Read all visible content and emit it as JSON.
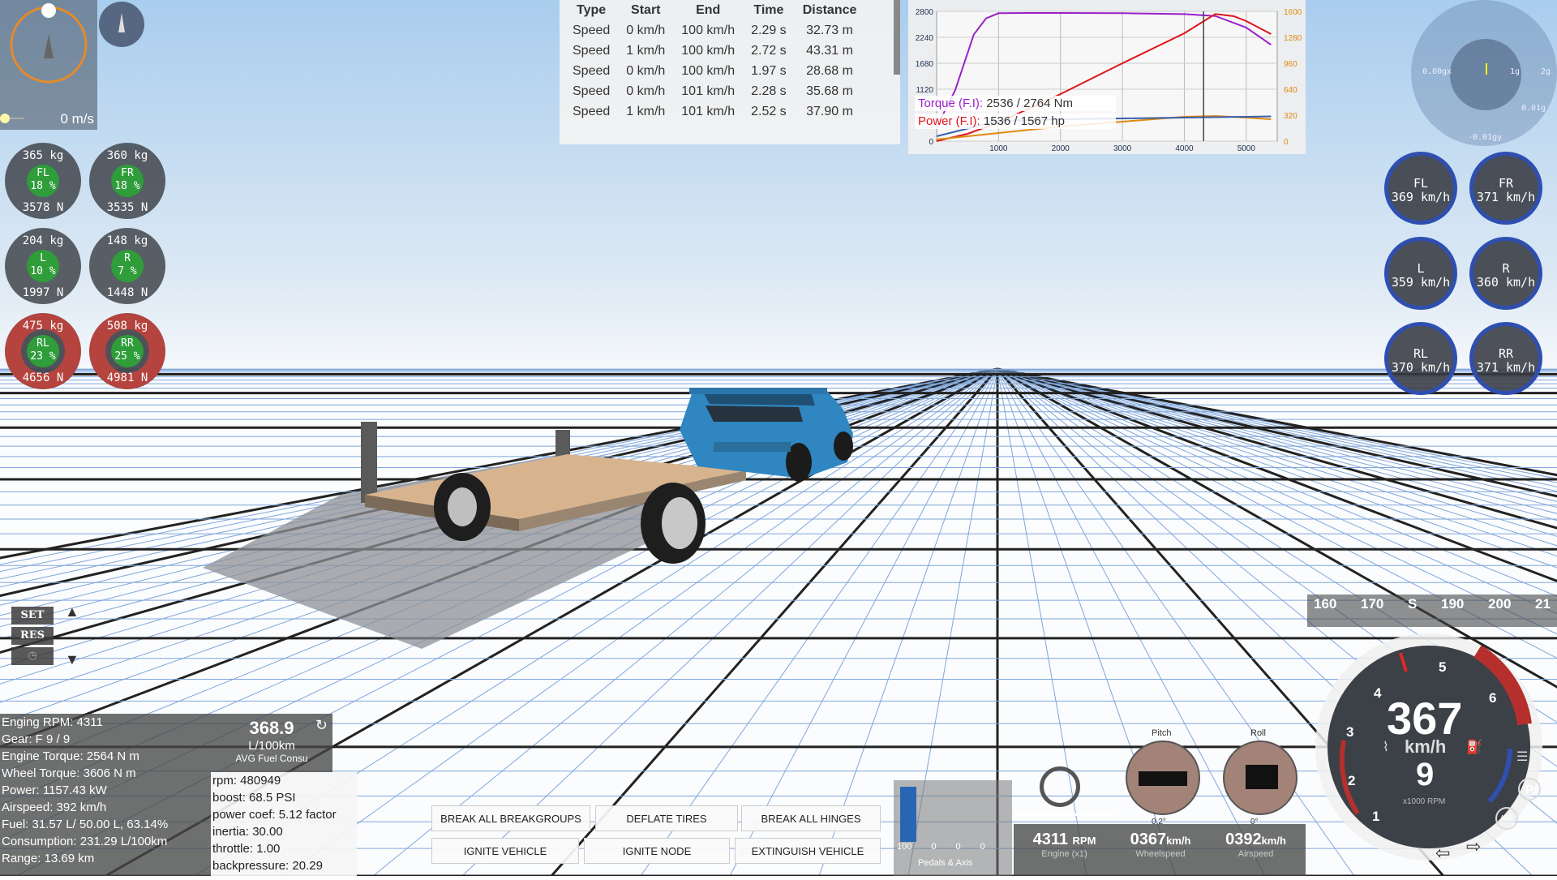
{
  "velocity": {
    "speed": "0 m/s"
  },
  "timing": {
    "headers": [
      "Type",
      "Start",
      "End",
      "Time",
      "Distance"
    ],
    "rows": [
      [
        "Speed",
        "0 km/h",
        "100 km/h",
        "2.29 s",
        "32.73 m"
      ],
      [
        "Speed",
        "1 km/h",
        "100 km/h",
        "2.72 s",
        "43.31 m"
      ],
      [
        "Speed",
        "0 km/h",
        "100 km/h",
        "1.97 s",
        "28.68 m"
      ],
      [
        "Speed",
        "0 km/h",
        "101 km/h",
        "2.28 s",
        "35.68 m"
      ],
      [
        "Speed",
        "1 km/h",
        "101 km/h",
        "2.52 s",
        "37.90 m"
      ]
    ]
  },
  "chart_data": {
    "type": "line",
    "x_ticks": [
      "1000",
      "2000",
      "3000",
      "4000",
      "5000"
    ],
    "y_left_ticks": [
      "2800",
      "2240",
      "1680",
      "1120",
      "0"
    ],
    "y_right_ticks": [
      "1600",
      "1280",
      "960",
      "640",
      "320",
      "0"
    ],
    "xlim": [
      0,
      5500
    ],
    "ylim_left": [
      0,
      2800
    ],
    "ylim_right": [
      0,
      1600
    ],
    "legend": {
      "torque_name": "Torque (F.I):",
      "torque_value": "2536 / 2764 Nm",
      "power_name": "Power (F.I):",
      "power_value": "1536 / 1567 hp"
    },
    "series": [
      {
        "name": "Torque (F.I)",
        "color": "#9b1fc9",
        "axis": "left",
        "x": [
          0,
          300,
          600,
          800,
          1000,
          1500,
          2000,
          3000,
          4000,
          4500,
          5000,
          5400
        ],
        "y": [
          300,
          1100,
          2300,
          2650,
          2760,
          2764,
          2764,
          2760,
          2740,
          2700,
          2450,
          2080
        ]
      },
      {
        "name": "Power (F.I)",
        "color": "#e0141a",
        "axis": "right",
        "x": [
          0,
          500,
          1000,
          2000,
          3000,
          4000,
          4500,
          4800,
          5000,
          5400
        ],
        "y": [
          0,
          90,
          230,
          580,
          960,
          1330,
          1567,
          1540,
          1480,
          1320
        ]
      },
      {
        "name": "",
        "color": "#e08a10",
        "axis": "right",
        "x": [
          0,
          1000,
          2000,
          3000,
          4000,
          4500,
          5000,
          5400
        ],
        "y": [
          20,
          100,
          180,
          240,
          300,
          310,
          290,
          270
        ]
      },
      {
        "name": "",
        "color": "#3a5fb0",
        "axis": "right",
        "x": [
          0,
          1000,
          2000,
          3000,
          4000,
          5000,
          5400
        ],
        "y": [
          60,
          250,
          270,
          280,
          290,
          300,
          305
        ]
      }
    ],
    "rpm_marker": 4311
  },
  "wheels_left": [
    {
      "kg": "365 kg",
      "label": "FL",
      "pct": "18 %",
      "n": "3578 N",
      "warn": false
    },
    {
      "kg": "360 kg",
      "label": "FR",
      "pct": "18 %",
      "n": "3535 N",
      "warn": false
    },
    {
      "kg": "204 kg",
      "label": "L",
      "pct": "10 %",
      "n": "1997 N",
      "warn": false
    },
    {
      "kg": "148 kg",
      "label": "R",
      "pct": "7 %",
      "n": "1448 N",
      "warn": false
    },
    {
      "kg": "475 kg",
      "label": "RL",
      "pct": "23 %",
      "n": "4656 N",
      "warn": true
    },
    {
      "kg": "508 kg",
      "label": "RR",
      "pct": "25 %",
      "n": "4981 N",
      "warn": true
    }
  ],
  "wheels_right": [
    {
      "label": "FL",
      "speed": "369 km/h"
    },
    {
      "label": "FR",
      "speed": "371 km/h"
    },
    {
      "label": "L",
      "speed": "359 km/h"
    },
    {
      "label": "R",
      "speed": "360 km/h"
    },
    {
      "label": "RL",
      "speed": "370 km/h"
    },
    {
      "label": "RR",
      "speed": "371 km/h"
    }
  ],
  "gforce": {
    "x": "0.00gx",
    "y": "-0.01gy",
    "z": "0.01g",
    "ring1": "1g",
    "ring2": "2g"
  },
  "cruise": {
    "set": "SET",
    "res": "RES"
  },
  "stats": {
    "rpm": "Enging RPM: 4311",
    "gear": "Gear: F 9 / 9",
    "engine_torque": "Engine Torque: 2564 N m",
    "wheel_torque": "Wheel Torque: 3606 N m",
    "power": "Power: 1157.43 kW",
    "airspeed": "Airspeed: 392 km/h",
    "fuel": "Fuel: 31.57 L/ 50.00 L, 63.14%",
    "consumption": "Consumption: 231.29 L/100km",
    "range": "Range: 13.69 km"
  },
  "fuel_widget": {
    "value": "368.9",
    "unit": "L/100km",
    "caption": "AVG Fuel Consu"
  },
  "engine_debug": {
    "rpm": "rpm: 480949",
    "boost": "boost: 68.5 PSI",
    "power_coef": "power coef: 5.12 factor",
    "inertia": "inertia: 30.00",
    "throttle": "throttle: 1.00",
    "backpressure": "backpressure: 20.29"
  },
  "actions": {
    "break_breakgroups": "BREAK ALL BREAKGROUPS",
    "deflate_tires": "DEFLATE TIRES",
    "break_hinges": "BREAK ALL HINGES",
    "ignite_vehicle": "IGNITE VEHICLE",
    "ignite_node": "IGNITE NODE",
    "extinguish_vehicle": "EXTINGUISH VEHICLE"
  },
  "pedals": {
    "values": [
      "100",
      "0",
      "0",
      "0"
    ],
    "caption": "Pedals & Axis",
    "throttle_level": 1.0
  },
  "readouts": {
    "engine_value": "4311",
    "engine_unit": "RPM",
    "engine_caption": "Engine (x1)",
    "wheel_value": "0367",
    "wheel_unit": "km/h",
    "wheel_caption": "Wheelspeed",
    "air_value": "0392",
    "air_unit": "km/h",
    "air_caption": "Airspeed"
  },
  "attitude": {
    "pitch_label": "Pitch",
    "roll_label": "Roll",
    "pitch_value": "0.2°",
    "roll_value": "0°"
  },
  "heading_tape": {
    "labels": [
      "160",
      "170",
      "S",
      "190",
      "200",
      "21"
    ]
  },
  "dash": {
    "speed": "367",
    "speed_unit": "km/h",
    "gear": "9",
    "rpm_caption": "x1000 RPM",
    "park_label": "P",
    "abs_label": "ABS",
    "rpm_ticks": [
      "1",
      "2",
      "3",
      "4",
      "5",
      "6"
    ]
  },
  "colors": {
    "sky_top": "#a9cdee",
    "accent_blue": "#2f4fb0",
    "warn_red": "#b5433e",
    "ok_green": "#2e9d3a",
    "torque": "#9b1fc9",
    "power": "#e0141a"
  }
}
